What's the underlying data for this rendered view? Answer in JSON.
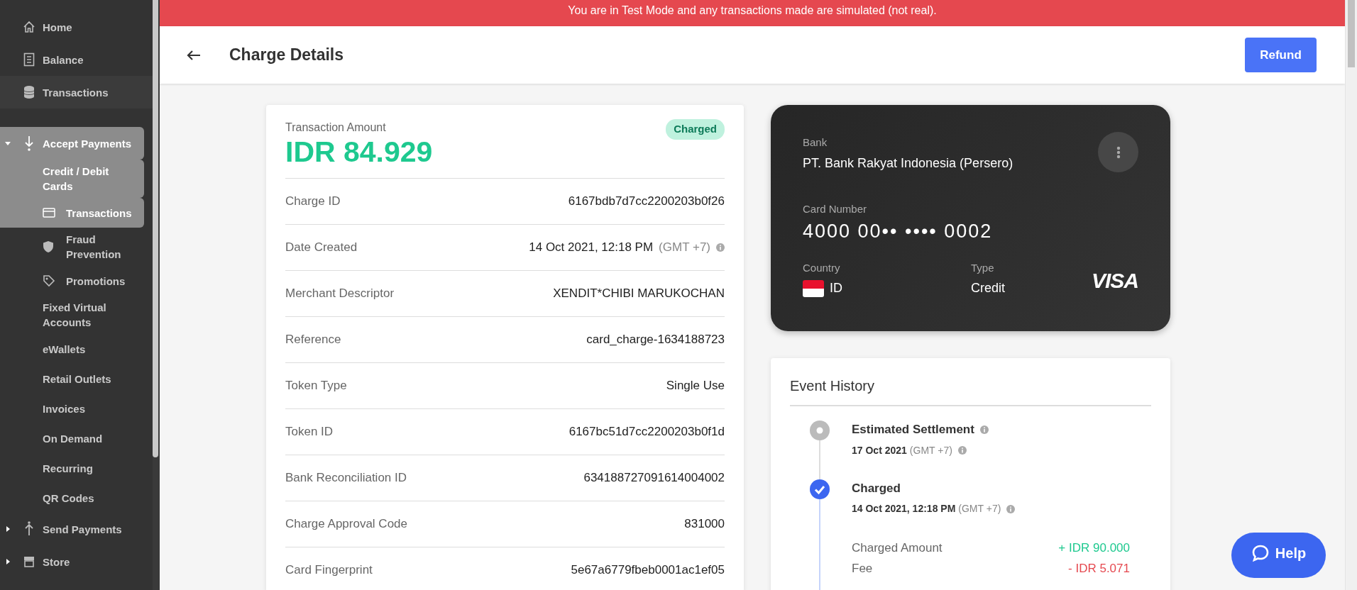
{
  "sidebar": {
    "items": [
      {
        "label": "Home",
        "selected": false,
        "highlighted": false
      },
      {
        "label": "Balance",
        "selected": false,
        "highlighted": false
      },
      {
        "label": "Transactions",
        "selected": false,
        "highlighted": true
      },
      {
        "label": "Accept Payments",
        "selected": true,
        "highlighted": false,
        "expanded": true,
        "children": [
          {
            "label": "Credit / Debit Cards",
            "selected": true,
            "children": [
              {
                "label": "Transactions",
                "selected": true
              },
              {
                "label": "Fraud Prevention",
                "selected": false
              },
              {
                "label": "Promotions",
                "selected": false
              }
            ]
          },
          {
            "label": "Fixed Virtual Accounts",
            "selected": false
          },
          {
            "label": "eWallets",
            "selected": false
          },
          {
            "label": "Retail Outlets",
            "selected": false
          },
          {
            "label": "Invoices",
            "selected": false
          },
          {
            "label": "On Demand",
            "selected": false
          },
          {
            "label": "Recurring",
            "selected": false
          },
          {
            "label": "QR Codes",
            "selected": false
          }
        ]
      },
      {
        "label": "Send Payments",
        "selected": false,
        "highlighted": false,
        "expanded": false
      },
      {
        "label": "Store",
        "selected": false,
        "highlighted": false,
        "expanded": false
      }
    ]
  },
  "banner": "You are in Test Mode and any transactions made are simulated (not real).",
  "header": {
    "title": "Charge Details",
    "button": "Refund"
  },
  "summary": {
    "label": "Transaction Amount",
    "amount": "IDR 84.929",
    "status": "Charged"
  },
  "details": [
    {
      "label": "Charge ID",
      "value": "6167bdb7d7cc2200203b0f26"
    },
    {
      "label": "Date Created",
      "value": "14 Oct 2021, 12:18 PM",
      "timezone": "(GMT +7)"
    },
    {
      "label": "Merchant Descriptor",
      "value": "XENDIT*CHIBI MARUKOCHAN"
    },
    {
      "label": "Reference",
      "value": "card_charge-1634188723"
    },
    {
      "label": "Token Type",
      "value": "Single Use"
    },
    {
      "label": "Token ID",
      "value": "6167bc51d7cc2200203b0f1d"
    },
    {
      "label": "Bank Reconciliation ID",
      "value": "634188727091614004002"
    },
    {
      "label": "Charge Approval Code",
      "value": "831000"
    },
    {
      "label": "Card Fingerprint",
      "value": "5e67a6779fbeb0001ac1ef05"
    }
  ],
  "card": {
    "bank_label": "Bank",
    "bank": "PT. Bank Rakyat Indonesia (Persero)",
    "number_label": "Card Number",
    "number": "4000 00•• •••• 0002",
    "country_label": "Country",
    "country": "ID",
    "type_label": "Type",
    "type": "Credit",
    "network": "VISA"
  },
  "events": {
    "title": "Event History",
    "items": [
      {
        "kind": "pending",
        "title": "Estimated Settlement",
        "date": "17 Oct 2021",
        "timezone": "(GMT +7)"
      },
      {
        "kind": "done",
        "title": "Charged",
        "date": "14 Oct 2021, 12:18 PM",
        "timezone": "(GMT +7)",
        "lines": [
          {
            "label": "Charged Amount",
            "value": "+ IDR 90.000",
            "kind": "credit"
          },
          {
            "label": "Fee",
            "value": "- IDR 5.071",
            "kind": "debit"
          }
        ]
      }
    ]
  },
  "help": "Help"
}
